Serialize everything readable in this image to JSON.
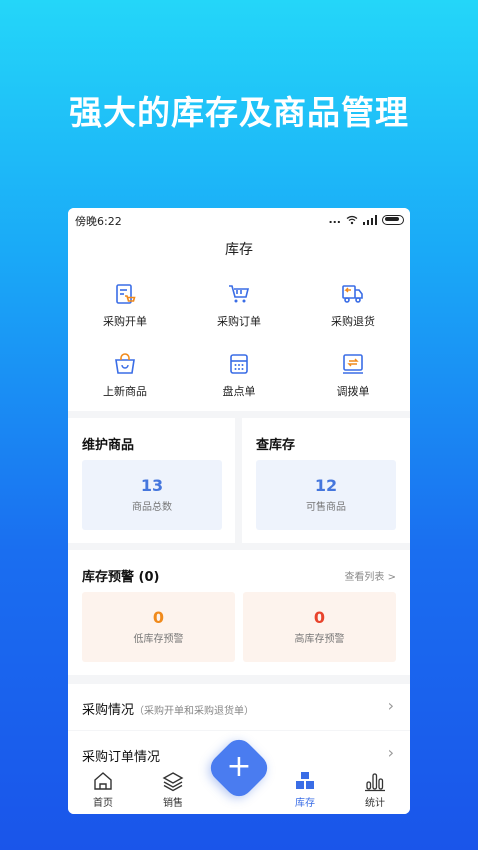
{
  "headline": "强大的库存及商品管理",
  "status": {
    "time": "傍晚6:22",
    "dots": "..."
  },
  "title": "库存",
  "grid": [
    {
      "label": "采购开单",
      "icon": "purchase-bill-icon"
    },
    {
      "label": "采购订单",
      "icon": "cart-icon"
    },
    {
      "label": "采购退货",
      "icon": "return-truck-icon"
    },
    {
      "label": "上新商品",
      "icon": "shopping-bag-icon"
    },
    {
      "label": "盘点单",
      "icon": "calculator-icon"
    },
    {
      "label": "调拨单",
      "icon": "transfer-icon"
    }
  ],
  "maintain": {
    "title": "维护商品",
    "value": "13",
    "caption": "商品总数"
  },
  "stock": {
    "title": "查库存",
    "value": "12",
    "caption": "可售商品"
  },
  "alert": {
    "title": "库存预警 (0)",
    "link": "查看列表 >",
    "low": {
      "value": "0",
      "caption": "低库存预警"
    },
    "high": {
      "value": "0",
      "caption": "高库存预警"
    }
  },
  "rows": [
    {
      "title": "采购情况",
      "sub": "（采购开单和采购退货单）"
    },
    {
      "title": "采购订单情况",
      "sub": ""
    }
  ],
  "tabs": [
    {
      "label": "首页",
      "icon": "home-icon"
    },
    {
      "label": "销售",
      "icon": "layers-icon"
    },
    {
      "label": "库存",
      "icon": "boxes-icon"
    },
    {
      "label": "统计",
      "icon": "bar-chart-icon"
    }
  ],
  "fab_symbol": "+",
  "colors": {
    "accent": "#3a6de6",
    "orange": "#f08a1c",
    "red": "#e8432c"
  }
}
